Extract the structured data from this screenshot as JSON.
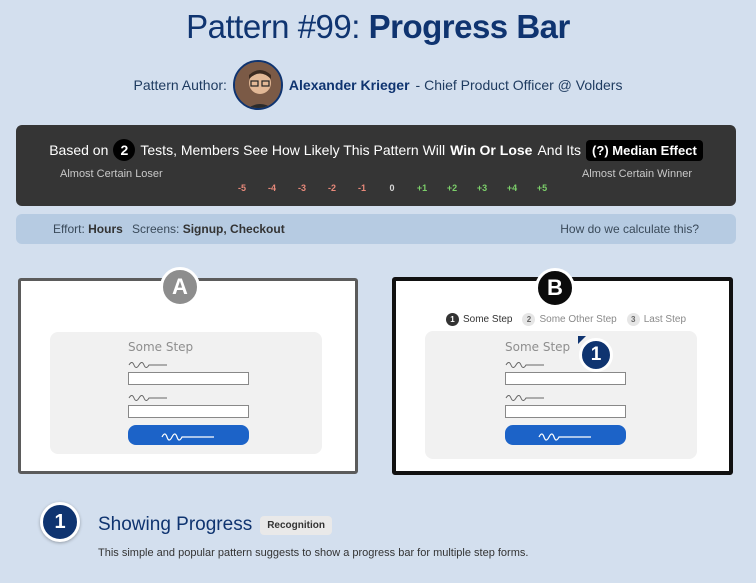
{
  "header": {
    "pattern_number": "Pattern #99:",
    "pattern_name": "Progress Bar"
  },
  "author": {
    "label": "Pattern Author:",
    "name": "Alexander Krieger",
    "role": "- Chief Product Officer @ Volders"
  },
  "prediction": {
    "prefix": "Based on",
    "tests_count": "2",
    "middle": "Tests, Members See How Likely This Pattern Will",
    "emphasis": "Win Or Lose",
    "suffix": "And Its",
    "median_label": "(?) Median Effect",
    "left_label": "Almost Certain Loser",
    "right_label": "Almost Certain Winner",
    "scale": [
      {
        "label": "-5",
        "color": "#e8897a"
      },
      {
        "label": "-4",
        "color": "#e8897a"
      },
      {
        "label": "-3",
        "color": "#e8897a"
      },
      {
        "label": "-2",
        "color": "#e8897a"
      },
      {
        "label": "-1",
        "color": "#e8897a"
      },
      {
        "label": "0",
        "color": "#d8d8d8"
      },
      {
        "label": "+1",
        "color": "#7ccf6a"
      },
      {
        "label": "+2",
        "color": "#7ccf6a"
      },
      {
        "label": "+3",
        "color": "#7ccf6a"
      },
      {
        "label": "+4",
        "color": "#7ccf6a"
      },
      {
        "label": "+5",
        "color": "#7ccf6a"
      }
    ]
  },
  "info": {
    "effort_label": "Effort:",
    "effort_value": "Hours",
    "screens_label": "Screens:",
    "screens_value": "Signup, Checkout",
    "how_link": "How do we calculate this?"
  },
  "variant_a": {
    "letter": "A",
    "step_label": "Some Step"
  },
  "variant_b": {
    "letter": "B",
    "step_label": "Some Step",
    "callout": "1",
    "progress_steps": [
      {
        "num": "1",
        "label": "Some Step"
      },
      {
        "num": "2",
        "label": "Some Other Step"
      },
      {
        "num": "3",
        "label": "Last Step"
      }
    ]
  },
  "principle": {
    "number": "1",
    "title": "Showing Progress",
    "tag": "Recognition",
    "description": "This simple and popular pattern suggests to show a progress bar for multiple step forms."
  },
  "colors": {
    "background": "#d3dfee",
    "brand_navy": "#0f3470",
    "panel_dark": "#353535",
    "button_blue": "#1c63c8"
  }
}
